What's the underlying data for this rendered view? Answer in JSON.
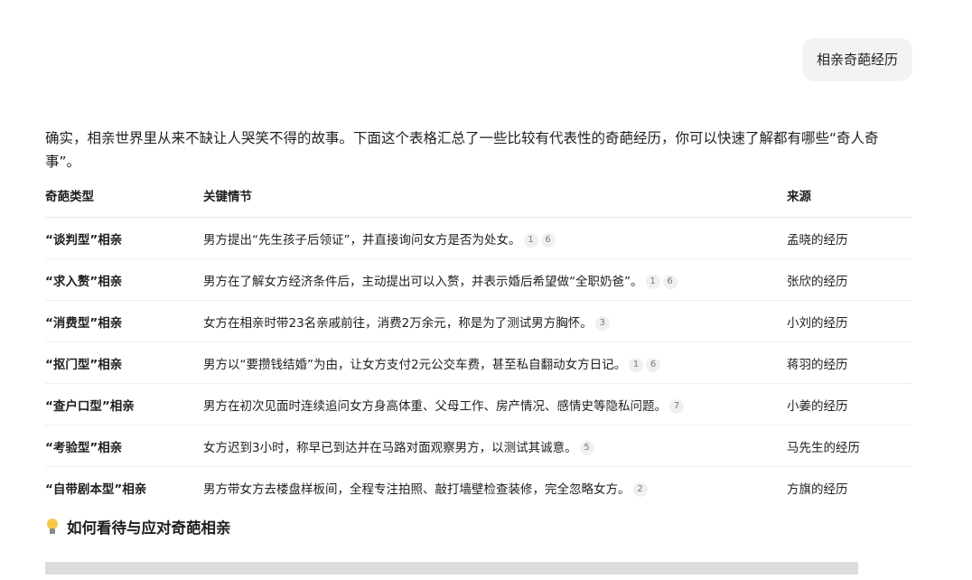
{
  "user_message": "相亲奇葩经历",
  "answer": {
    "intro": "确实，相亲世界里从来不缺让人哭笑不得的故事。下面这个表格汇总了一些比较有代表性的奇葩经历，你可以快速了解都有哪些“奇人奇事”。",
    "table": {
      "headers": [
        "奇葩类型",
        "关键情节",
        "来源"
      ],
      "rows": [
        {
          "type": "“谈判型”相亲",
          "plot": "男方提出“先生孩子后领证”，并直接询问女方是否为处女。",
          "cites": [
            "1",
            "6"
          ],
          "source": "孟晓的经历"
        },
        {
          "type": "“求入赘”相亲",
          "plot": "男方在了解女方经济条件后，主动提出可以入赘，并表示婚后希望做“全职奶爸”。",
          "cites": [
            "1",
            "6"
          ],
          "source": "张欣的经历"
        },
        {
          "type": "“消费型”相亲",
          "plot": "女方在相亲时带23名亲戚前往，消费2万余元，称是为了测试男方胸怀。",
          "cites": [
            "3"
          ],
          "source": "小刘的经历"
        },
        {
          "type": "“抠门型”相亲",
          "plot": "男方以“要攒钱结婚”为由，让女方支付2元公交车费，甚至私自翻动女方日记。",
          "cites": [
            "1",
            "6"
          ],
          "source": "蒋羽的经历"
        },
        {
          "type": "“查户口型”相亲",
          "plot": "男方在初次见面时连续追问女方身高体重、父母工作、房产情况、感情史等隐私问题。",
          "cites": [
            "7"
          ],
          "source": "小姜的经历"
        },
        {
          "type": "“考验型”相亲",
          "plot": "女方迟到3小时，称早已到达并在马路对面观察男方，以测试其诚意。",
          "cites": [
            "5"
          ],
          "source": "马先生的经历"
        },
        {
          "type": "“自带剧本型”相亲",
          "plot": "男方带女方去楼盘样板间，全程专注拍照、敲打墙壁检查装修，完全忽略女方。",
          "cites": [
            "2"
          ],
          "source": "方旗的经历"
        }
      ]
    },
    "section_heading": "如何看待与应对奇葩相亲",
    "section_icon": "lightbulb-icon"
  }
}
